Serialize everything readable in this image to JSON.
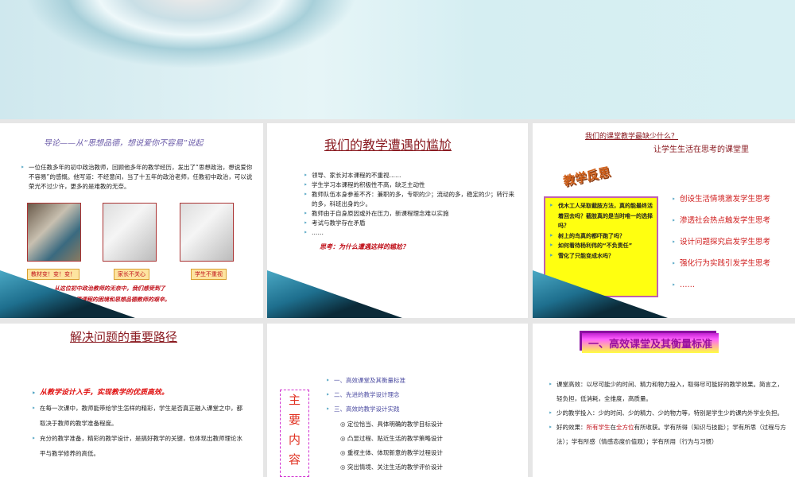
{
  "slide1": {
    "title": "导论——从“思想品德，想说爱你不容易”说起",
    "body": "一位任教多年的初中政治教师，回顾他多年的教学经历，发出了“思想政治，想说爱你不容易”的感慨。他写道：不经意间，当了十五年的政治老师，任教初中政治，可以说荣光不过少许，更多的是难教的无奈。",
    "captions": [
      "教材变！变！变！",
      "家长不关心",
      "学生不重视"
    ],
    "footer_line1": "从这位初中政治教师的无奈中，我们感受到了",
    "footer_line2": "初中思想品德课程的困境和思想品德教师的艰辛。"
  },
  "slide2": {
    "title": "我们的教学遭遇的尴尬",
    "items": [
      "领导、家长对本课程的不重视……",
      "学生学习本课程的积极性不高，缺乏主动性",
      "教师队伍本身参差不齐：兼职的多，专职的少；流动的多，稳定的少；转行来的多，科班出身的少。",
      "教师由于自身原因或外在压力，新课程理念难以实施",
      "考试与教学存在矛盾",
      "……"
    ],
    "question": "思考：为什么遭遇这样的尴尬？"
  },
  "slide3": {
    "title": "我们的课堂教学最缺少什么？",
    "subtitle": "让学生生活在思考的课堂里",
    "wordart": "教学反思",
    "box_items": [
      "伐木工人采取截肢方法，真的能最终活着回去吗？截肢真的是当时唯一的选择吗？",
      "树上的鸟真的都吓跑了吗？",
      "如何看待杨利伟的“不负责任”",
      "雪化了只能变成水吗？"
    ],
    "box_more": "……",
    "items": [
      "创设生活情境激发学生思考",
      "渗透社会热点触发学生思考",
      "设计问题探究启发学生思考",
      "强化行为实践引发学生思考",
      "……"
    ]
  },
  "slide4": {
    "title": "解决问题的重要路径",
    "items": [
      "从教学设计入手，实现教学的优质高效。",
      "在每一次课中，教师能带给学生怎样的精彩，学生是否真正融入课堂之中，都取决于教师的教学准备程度。",
      "充分的教学准备，精彩的教学设计，是搞好教学的关键，也体现出教师理论水平与教学修养的高低。"
    ]
  },
  "slide5": {
    "stamp": [
      "主",
      "要",
      "内",
      "容"
    ],
    "items": [
      "一、高效课堂及其衡量标准",
      "二、先进的教学设计理念",
      "三、高效的教学设计实践"
    ],
    "subitems": [
      "◎ 定位恰当、具体明确的教学目标设计",
      "◎ 凸显过程、贴近生活的教学策略设计",
      "◎ 重视主体、体现新意的教学过程设计",
      "◎ 突出情境、关注生活的教学评价设计"
    ]
  },
  "slide6": {
    "title": "一、高效课堂及其衡量标准",
    "item1": "课堂高效：以尽可能少的时间、精力和物力投入，取得尽可能好的教学效果。简言之，轻负担，低消耗，全维度，高质量。",
    "item2": "少的教学投入：少的时间、少的精力、少的物力等，特别是学生少的课内外学业负担。",
    "item3_a": "好的效果：",
    "item3_b": "所有学生",
    "item3_c": "在",
    "item3_d": "全方位",
    "item3_e": "有所收获。学有所得（知识与技能）；学有所思（过程与方法）；学有所感（情感态度价值观）；学有所用（行为与习惯）"
  }
}
